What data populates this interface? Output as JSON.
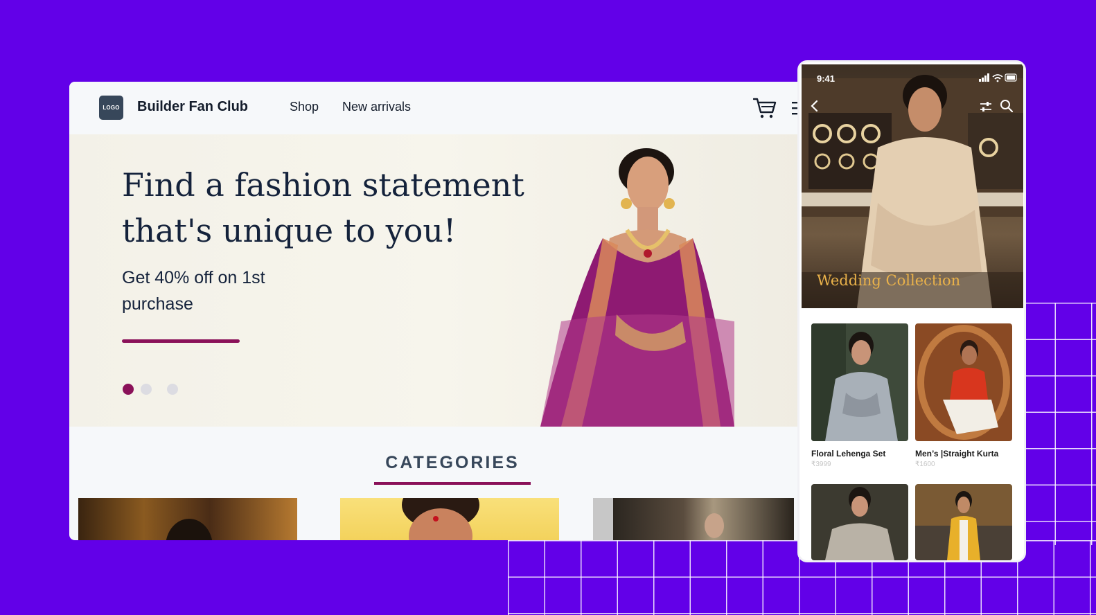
{
  "desktop": {
    "logo_text": "LOGO",
    "brand": "Builder Fan Club",
    "nav": [
      "Shop",
      "New arrivals"
    ],
    "icons": [
      "cart-icon",
      "menu-icon"
    ],
    "hero": {
      "title": "Find a fashion statement that's unique to you!",
      "subtitle": "Get 40% off on 1st purchase",
      "slides": 3,
      "active_slide": 1
    },
    "categories_title": "CATEGORIES"
  },
  "phone": {
    "status_time": "9:41",
    "banner_title": "Wedding Collection",
    "icons": [
      "back-icon",
      "filter-icon",
      "search-icon"
    ],
    "products": [
      {
        "name": "Floral Lehenga Set",
        "price": "₹3999"
      },
      {
        "name": "Men’s |Straight Kurta",
        "price": "₹1600"
      },
      {
        "name": "",
        "price": ""
      },
      {
        "name": "",
        "price": ""
      }
    ]
  },
  "colors": {
    "background": "#6200e8",
    "accent": "#8a1159",
    "heading": "#14223b",
    "gold": "#eab24a"
  }
}
